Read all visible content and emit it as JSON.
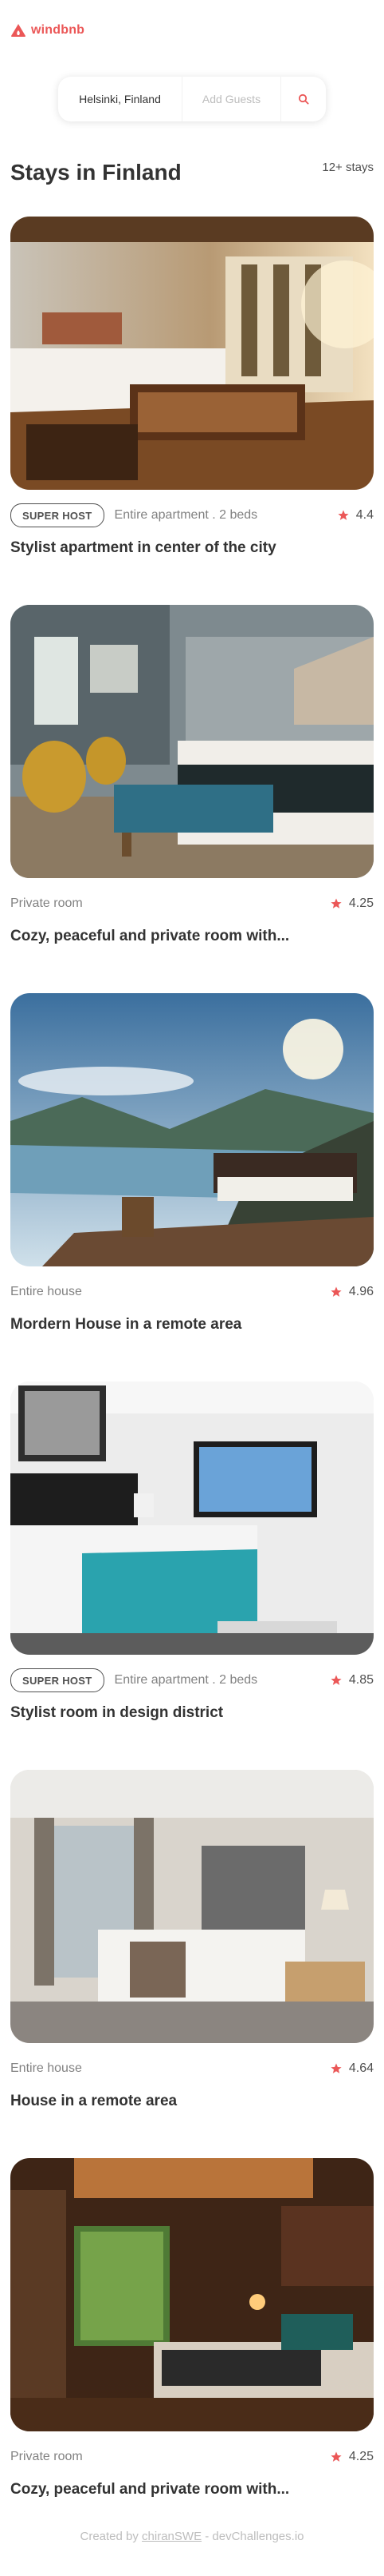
{
  "brand": {
    "name": "windbnb",
    "color": "#eb5757"
  },
  "search": {
    "location": "Helsinki, Finland",
    "guests_placeholder": "Add Guests",
    "icon": "search-icon"
  },
  "section": {
    "title": "Stays in Finland",
    "count": "12+ stays"
  },
  "stays": [
    {
      "superhost": true,
      "superhost_label": "SUPER HOST",
      "type": "Entire apartment . 2 beds",
      "rating": "4.4",
      "title": "Stylist apartment in center of the city",
      "image": "bedroom with wooden floor and sunlit windows"
    },
    {
      "superhost": false,
      "superhost_label": "",
      "type": "Private room",
      "rating": "4.25",
      "title": "Cozy, peaceful and private room with...",
      "image": "bedroom with teal bench and yellow chairs"
    },
    {
      "superhost": false,
      "superhost_label": "",
      "type": "Entire house",
      "rating": "4.96",
      "title": "Mordern House in a remote area",
      "image": "outdoor bed on wooden deck over a fjord"
    },
    {
      "superhost": true,
      "superhost_label": "SUPER HOST",
      "type": "Entire apartment . 2 beds",
      "rating": "4.85",
      "title": "Stylist room in design district",
      "image": "white bedroom with teal throw"
    },
    {
      "superhost": false,
      "superhost_label": "",
      "type": "Entire house",
      "rating": "4.64",
      "title": "House in a remote area",
      "image": "grey modern bedroom with city window"
    },
    {
      "superhost": false,
      "superhost_label": "",
      "type": "Private room",
      "rating": "4.25",
      "title": "Cozy, peaceful and private room with...",
      "image": "warm wooden bedroom with garden view"
    }
  ],
  "footer": {
    "prefix": "Created by",
    "author": "chiranSWE",
    "suffix": "- devChallenges.io"
  },
  "colors": {
    "accent": "#eb5757",
    "text": "#333333",
    "muted": "#828282"
  }
}
